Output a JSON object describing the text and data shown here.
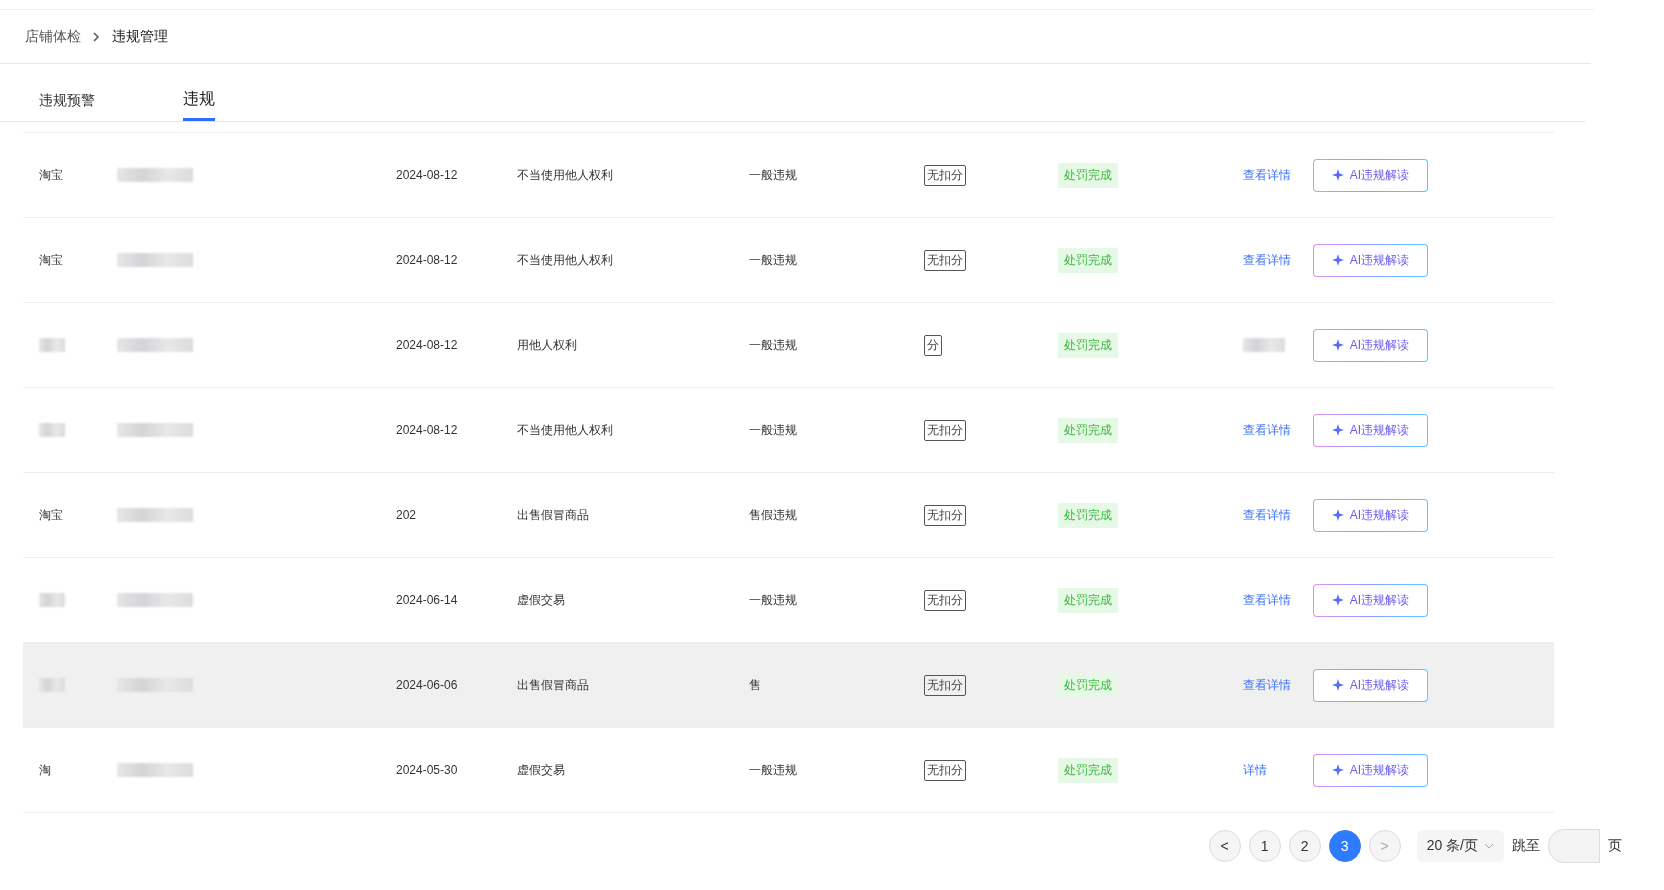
{
  "breadcrumb": [
    {
      "label": "店铺体检"
    },
    {
      "label": "违规管理"
    }
  ],
  "tabs": [
    {
      "label": "违规预警",
      "selected": false
    },
    {
      "label": "违规",
      "selected": true
    }
  ],
  "rows": [
    {
      "platform": "淘宝",
      "date": "2024-08-12",
      "reason": "不当使用他人权利",
      "type": "一般违规",
      "deduction": "无扣分",
      "status": "处罚完成",
      "detail": "查看详情",
      "ai": "AI违规解读",
      "highlighted": false
    },
    {
      "platform": "淘宝",
      "date": "2024-08-12",
      "reason": "不当使用他人权利",
      "type": "一般违规",
      "deduction": "无扣分",
      "status": "处罚完成",
      "detail": "查看详情",
      "ai": "AI违规解读",
      "highlighted": false
    },
    {
      "date": "2024-08-12",
      "reason": "用他人权利",
      "type": "一般违规",
      "deduction": "分",
      "status": "处罚完成",
      "ai": "AI违规解读",
      "highlighted": false
    },
    {
      "date": "2024-08-12",
      "reason": "不当使用他人权利",
      "type": "一般违规",
      "deduction": "无扣分",
      "status": "处罚完成",
      "detail": "查看详情",
      "ai": "AI违规解读",
      "highlighted": false
    },
    {
      "platform": "淘宝",
      "date": "202",
      "reason": "出售假冒商品",
      "type": "售假违规",
      "deduction": "无扣分",
      "status": "处罚完成",
      "detail": "查看详情",
      "ai": "AI违规解读",
      "highlighted": false
    },
    {
      "date": "2024-06-14",
      "reason": "虚假交易",
      "type": "一般违规",
      "deduction": "无扣分",
      "status": "处罚完成",
      "detail": "查看详情",
      "ai": "AI违规解读",
      "highlighted": false
    },
    {
      "date": "2024-06-06",
      "reason": "出售假冒商品",
      "type": "售",
      "deduction": "无扣分",
      "status": "处罚完成",
      "detail": "查看详情",
      "ai": "AI违规解读",
      "highlighted": true
    },
    {
      "platform": "淘",
      "date": "2024-05-30",
      "reason": "虚假交易",
      "type": "一般违规",
      "deduction": "无扣分",
      "status": "处罚完成",
      "detail": "详情",
      "ai": "AI违规解读",
      "highlighted": false
    }
  ],
  "pagination": {
    "prev": "<",
    "next": ">",
    "pages": [
      {
        "label": "1",
        "selected": false
      },
      {
        "label": "2",
        "selected": false
      },
      {
        "label": "3",
        "selected": true
      }
    ],
    "page_size": "20 条/页",
    "jump_label": "跳至",
    "page_suffix": "页"
  }
}
